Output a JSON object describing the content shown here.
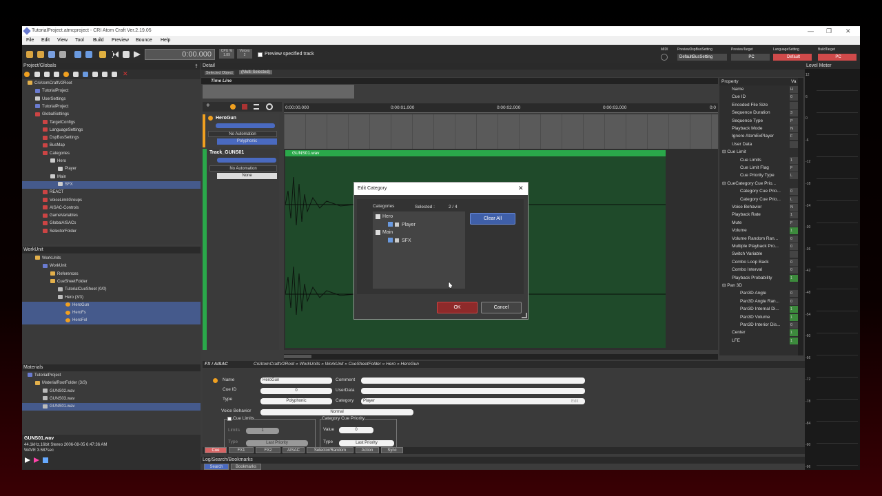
{
  "window": {
    "title": "TutorialProject.atmcproject - CRI Atom Craft Ver.2.19.05"
  },
  "menu": [
    "File",
    "Edit",
    "View",
    "Tool",
    "Build",
    "Preview",
    "Bounce",
    "Help"
  ],
  "toolbar": {
    "time": "0:00.000",
    "cpu_label": "CPU %",
    "cpu_value": "1.89",
    "voices_label": "Voices",
    "voices_value": "2",
    "preview_specified_track": "Preview specified track",
    "midi": "MIDI",
    "preview_dspbus_label": "PreviewDspBusSetting",
    "preview_dspbus_value": "DefaultBusSetting",
    "preview_target_label": "PreviewTarget",
    "preview_target_value": "PC",
    "language_label": "LanguageSetting",
    "language_value": "Default",
    "build_target_label": "BuildTarget",
    "build_target_value": "PC"
  },
  "project_globals": {
    "title": "Project/Globals",
    "items": [
      {
        "label": "CriAtomCraftV2Root",
        "depth": 0,
        "icon": "folder"
      },
      {
        "label": "TutorialProject",
        "depth": 1,
        "icon": "project"
      },
      {
        "label": "UserSettings",
        "depth": 1,
        "icon": "gear"
      },
      {
        "label": "TutorialProject",
        "depth": 1,
        "icon": "project"
      },
      {
        "label": "GlobalSettings",
        "depth": 1,
        "icon": "red-folder"
      },
      {
        "label": "TargetConfigs",
        "depth": 2,
        "icon": "red-folder"
      },
      {
        "label": "LanguageSettings",
        "depth": 2,
        "icon": "red-folder"
      },
      {
        "label": "DspBusSettings",
        "depth": 2,
        "icon": "red-folder"
      },
      {
        "label": "BusMap",
        "depth": 2,
        "icon": "red-folder"
      },
      {
        "label": "Categories",
        "depth": 2,
        "icon": "red-folder"
      },
      {
        "label": "Hero",
        "depth": 3,
        "icon": "category"
      },
      {
        "label": "Player",
        "depth": 4,
        "icon": "category"
      },
      {
        "label": "Main",
        "depth": 3,
        "icon": "category"
      },
      {
        "label": "SFX",
        "depth": 4,
        "icon": "category",
        "selected": true
      },
      {
        "label": "REACT",
        "depth": 2,
        "icon": "red-folder"
      },
      {
        "label": "VoiceLimitGroups",
        "depth": 2,
        "icon": "red-folder"
      },
      {
        "label": "AISAC-Controls",
        "depth": 2,
        "icon": "red-folder"
      },
      {
        "label": "GameVariables",
        "depth": 2,
        "icon": "red-folder"
      },
      {
        "label": "GlobalAISACs",
        "depth": 2,
        "icon": "red-folder"
      },
      {
        "label": "SelectorFolder",
        "depth": 2,
        "icon": "red-folder"
      }
    ]
  },
  "workunit": {
    "title": "WorkUnit",
    "items": [
      {
        "label": "WorkUnits",
        "depth": 1,
        "icon": "folder"
      },
      {
        "label": "WorkUnit",
        "depth": 2,
        "icon": "project"
      },
      {
        "label": "References",
        "depth": 3,
        "icon": "folder"
      },
      {
        "label": "CueSheetFolder",
        "depth": 3,
        "icon": "folder"
      },
      {
        "label": "TutorialCueSheet (0/0)",
        "depth": 4,
        "icon": "wav"
      },
      {
        "label": "Hero (3/3)",
        "depth": 4,
        "icon": "wav"
      },
      {
        "label": "HeroGun",
        "depth": 5,
        "icon": "cue",
        "selected": true
      },
      {
        "label": "HeroFs",
        "depth": 5,
        "icon": "cue",
        "selected": true
      },
      {
        "label": "HeroFol",
        "depth": 5,
        "icon": "cue",
        "selected": true
      }
    ]
  },
  "materials": {
    "title": "Materials",
    "items": [
      {
        "label": "TutorialProject",
        "depth": 0,
        "icon": "project"
      },
      {
        "label": "MaterialRootFolder (3/3)",
        "depth": 1,
        "icon": "folder"
      },
      {
        "label": "GUNS02.wav",
        "depth": 2,
        "icon": "wav"
      },
      {
        "label": "GUNS03.wav",
        "depth": 2,
        "icon": "wav"
      },
      {
        "label": "GUNS01.wav",
        "depth": 2,
        "icon": "wav",
        "selected": true
      }
    ],
    "info_name": "GUNS01.wav",
    "info_line1": "44.1kHz,16bit Stereo   2006-08-05 6:47:36 AM",
    "info_line2": "WAVE 3.587sec"
  },
  "detail": {
    "title": "Detail",
    "selected_object_label": "Selected Object",
    "selected_object_value": "(Multi Selected)",
    "timeline_title": "Time Line",
    "ruler": [
      "0:00:00.000",
      "0:00:01.000",
      "0:00:02.000",
      "0:00:03.000",
      "0:0"
    ],
    "track1": {
      "name": "HeroGun",
      "automation": "No Automation",
      "mode": "Polyphonic"
    },
    "track2": {
      "name": "Track_GUNS01",
      "automation": "No Automation",
      "mode": "None",
      "clip": "GUNS01.wav"
    },
    "breadcrumb_label": "FX / AISAC",
    "breadcrumb": "CriAtomCraftV2Root  »  WorkUnits  »  WorkUnit  »  CueSheetFolder  »  Hero  »  HeroGun"
  },
  "inspector": {
    "name_label": "Name",
    "name_value": "HeroGun",
    "comment_label": "Comment",
    "cueid_label": "Cue ID",
    "cueid_value": "0",
    "userdata_label": "UserData",
    "type_label": "Type",
    "type_value": "Polyphonic",
    "category_label": "Category",
    "category_value": "Player",
    "edit_label": "Edit",
    "voice_behavior_label": "Voice Behavior",
    "voice_behavior_value": "Normal",
    "cue_limits_label": "Cue Limits",
    "limits_label": "Limits",
    "limits_value": "1",
    "category_cue_priority_label": "Category Cue Priority",
    "value_label": "Value",
    "value_value": "0",
    "type2_label": "Type",
    "type2_value": "Last Priority",
    "type3_label": "Type",
    "type3_value": "Last Priority",
    "tabs": [
      "Cue",
      "FX1",
      "FX2",
      "AISAC",
      "Selector/Random",
      "Action",
      "Sync"
    ]
  },
  "log": {
    "title": "Log/Search/Bookmarks",
    "tabs": [
      "Search",
      "Bookmarks"
    ]
  },
  "property": {
    "header": "Property",
    "header_value": "Va",
    "rows": [
      {
        "label": "Name",
        "value": "H",
        "indent": 1
      },
      {
        "label": "Cue ID",
        "value": "0",
        "indent": 1
      },
      {
        "label": "Encoded File Size",
        "value": "",
        "indent": 1
      },
      {
        "label": "Sequence Duration",
        "value": "3",
        "indent": 1
      },
      {
        "label": "Sequence Type",
        "value": "P",
        "indent": 1
      },
      {
        "label": "Playback Mode",
        "value": "N",
        "indent": 1
      },
      {
        "label": "Ignore AtomExPlayer",
        "value": "F",
        "indent": 1
      },
      {
        "label": "User Data",
        "value": "",
        "indent": 1
      },
      {
        "label": "Cue Limit",
        "value": "",
        "indent": 1,
        "group": true
      },
      {
        "label": "Cue Limits",
        "value": "1",
        "indent": 2
      },
      {
        "label": "Cue Limit Flag",
        "value": "F",
        "indent": 2
      },
      {
        "label": "Cue Priority Type",
        "value": "L",
        "indent": 2
      },
      {
        "label": "CueCategory Cue Prio...",
        "value": "",
        "indent": 1,
        "group": true
      },
      {
        "label": "Category Cue Prio...",
        "value": "0",
        "indent": 2
      },
      {
        "label": "Category Cue Prio...",
        "value": "L",
        "indent": 2
      },
      {
        "label": "Voice Behavior",
        "value": "N",
        "indent": 1
      },
      {
        "label": "Playback Rate",
        "value": "1",
        "indent": 1
      },
      {
        "label": "Mute",
        "value": "F",
        "indent": 1
      },
      {
        "label": "Volume",
        "value": "1",
        "indent": 1,
        "green": true
      },
      {
        "label": "Volume Random Ran...",
        "value": "0",
        "indent": 1
      },
      {
        "label": "Multiple Playback Pro...",
        "value": "0",
        "indent": 1
      },
      {
        "label": "Switch Variable",
        "value": "",
        "indent": 1
      },
      {
        "label": "Combo Loop Back",
        "value": "0",
        "indent": 1
      },
      {
        "label": "Combo Interval",
        "value": "0",
        "indent": 1
      },
      {
        "label": "Playback Probability",
        "value": "1",
        "indent": 1,
        "green": true
      },
      {
        "label": "Pan 3D",
        "value": "",
        "indent": 1,
        "group": true
      },
      {
        "label": "Pan3D Angle",
        "value": "0",
        "indent": 2
      },
      {
        "label": "Pan3D Angle Ran...",
        "value": "0",
        "indent": 2
      },
      {
        "label": "Pan3D Internal Di...",
        "value": "1",
        "indent": 2,
        "green": true
      },
      {
        "label": "Pan3D Volume",
        "value": "1",
        "indent": 2,
        "green": true
      },
      {
        "label": "Pan3D Interior Dis...",
        "value": "0",
        "indent": 2
      },
      {
        "label": "Center",
        "value": "1",
        "indent": 1,
        "green": true
      },
      {
        "label": "LFE",
        "value": "1",
        "indent": 1,
        "green": true
      }
    ]
  },
  "level_meter": {
    "title": "Level Meter",
    "ticks": [
      "12",
      "6",
      "0",
      "-6",
      "-12",
      "-18",
      "-24",
      "-30",
      "-36",
      "-42",
      "-48",
      "-54",
      "-60",
      "-66",
      "-72",
      "-78",
      "-84",
      "-90",
      "-96"
    ]
  },
  "dialog": {
    "title": "Edit Category",
    "categories_label": "Categories",
    "selected_label": "Selected :",
    "selected_count": "2  / 4",
    "clear_all": "Clear All",
    "items": [
      {
        "label": "Hero",
        "depth": 0,
        "checked": false
      },
      {
        "label": "Player",
        "depth": 1,
        "checked": true
      },
      {
        "label": "Main",
        "depth": 0,
        "checked": false
      },
      {
        "label": "SFX",
        "depth": 1,
        "checked": true
      }
    ],
    "ok": "OK",
    "cancel": "Cancel"
  },
  "colors": {
    "accent_blue": "#4a6ac0",
    "ok_red": "#8e2a2a",
    "track_green": "#2aa84a",
    "hero_orange": "#f0a020"
  }
}
